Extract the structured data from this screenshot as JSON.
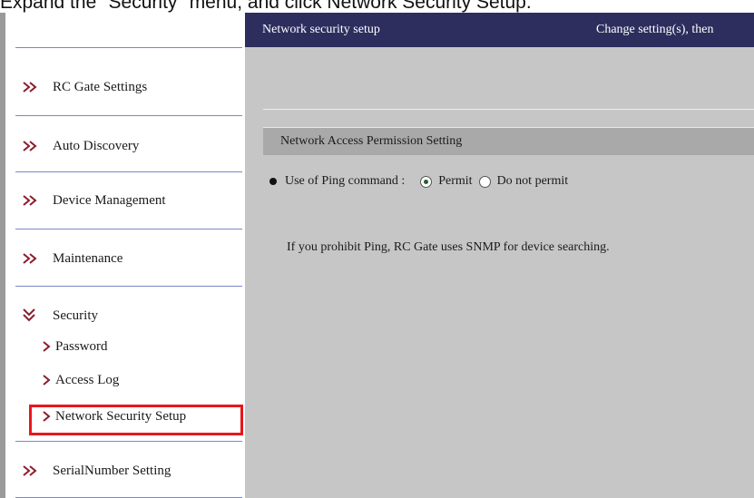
{
  "instruction": "Expand the \"Security\" menu, and click Network Security Setup.",
  "sidebar": {
    "items": [
      {
        "label": "RC Gate Settings",
        "icon": "double-chevron-right-icon"
      },
      {
        "label": "Auto Discovery",
        "icon": "double-chevron-right-icon"
      },
      {
        "label": "Device Management",
        "icon": "double-chevron-right-icon"
      },
      {
        "label": "Maintenance",
        "icon": "double-chevron-right-icon"
      },
      {
        "label": "Security",
        "icon": "double-chevron-down-icon",
        "expanded": true
      },
      {
        "label": "SerialNumber Setting",
        "icon": "double-chevron-right-icon"
      }
    ],
    "security_subitems": [
      {
        "label": "Password"
      },
      {
        "label": "Access Log"
      },
      {
        "label": "Network Security Setup",
        "highlighted": true
      }
    ]
  },
  "header": {
    "title": "Network security setup",
    "message": "Change setting(s), then"
  },
  "section": {
    "title": "Network Access Permission Setting"
  },
  "ping": {
    "label": "Use of Ping command :",
    "options": [
      "Permit",
      "Do not permit"
    ],
    "selected": "Permit"
  },
  "note": "If you prohibit Ping, RC Gate uses SNMP for device searching.",
  "colors": {
    "header_bg": "#2d2d5e",
    "main_bg": "#c6c6c6",
    "section_bg": "#a9a9a9",
    "separator": "#7c86c9",
    "highlight": "#e8161c"
  }
}
